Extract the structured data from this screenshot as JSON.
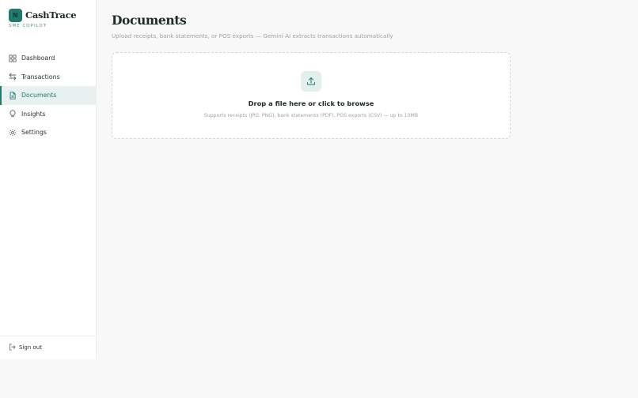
{
  "brand": {
    "logo_letter": "N",
    "name": "CashTrace",
    "tagline": "SME COPILOT"
  },
  "sidebar": {
    "items": [
      {
        "label": "Dashboard",
        "icon": "grid-icon"
      },
      {
        "label": "Transactions",
        "icon": "arrows-swap-icon"
      },
      {
        "label": "Documents",
        "icon": "document-icon",
        "active": true
      },
      {
        "label": "Insights",
        "icon": "lightbulb-icon"
      },
      {
        "label": "Settings",
        "icon": "gear-icon"
      }
    ],
    "signout_label": "Sign out"
  },
  "main": {
    "title": "Documents",
    "subtitle": "Upload receipts, bank statements, or POS exports — Gemini AI extracts transactions automatically",
    "dropzone": {
      "title": "Drop a file here or click to browse",
      "hint": "Supports receipts (JPG, PNG), bank statements (PDF), POS exports (CSV) — up to 10MB",
      "icon": "upload-icon"
    }
  },
  "colors": {
    "accent": "#1f7a6c",
    "active_bg": "#e7f1ef",
    "muted_text": "#9aa5a1",
    "page_bg": "#f7f8f7"
  }
}
